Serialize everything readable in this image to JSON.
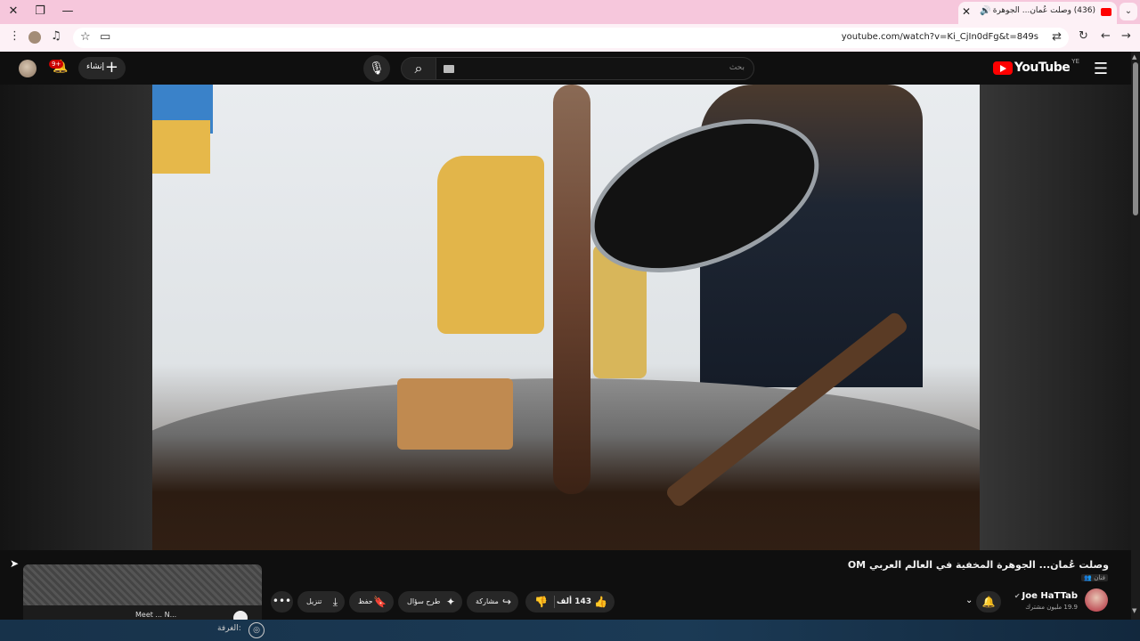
{
  "browser": {
    "tab_title": "(436) وصلت عُمان... الجوهرة",
    "tab_audio_icon": "speaker-icon",
    "tab_close": "✕",
    "new_tab": "+",
    "url": "youtube.com/watch?v=Ki_CjIn0dFg&t=849s"
  },
  "youtube": {
    "logo_text": "YouTube",
    "country_code": "YE",
    "search_placeholder": "بحث",
    "create_label": "إنشاء",
    "notif_badge": "9+"
  },
  "video": {
    "title": "وصلت عُمان... الجوهرة المخفية في العالم العربي OM",
    "sub_label": "فنان",
    "channel_name": "Joe HaTTab",
    "subscribers": "19.9 مليون مشترك",
    "likes": "143 ألف",
    "share_label": "مشاركة",
    "ask_label": "طرح سؤال",
    "save_label": "حفظ",
    "download_label": "تنزيل"
  },
  "preview": {
    "title": "Meet ... N..."
  },
  "taskbar": {
    "label": "الغرفة:"
  },
  "colors": {
    "accent": "#ff0000",
    "tabbar": "#f6c7dc",
    "background": "#0f0f0f"
  }
}
